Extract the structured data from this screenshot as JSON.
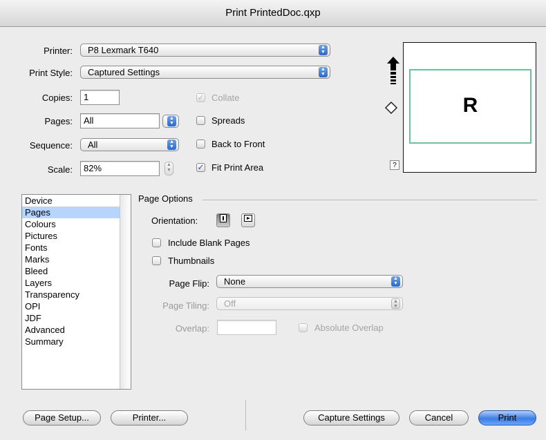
{
  "window": {
    "title": "Print PrintedDoc.qxp"
  },
  "form": {
    "printer_label": "Printer:",
    "printer_value": "P8 Lexmark T640",
    "style_label": "Print Style:",
    "style_value": "Captured Settings",
    "copies_label": "Copies:",
    "copies_value": "1",
    "pages_label": "Pages:",
    "pages_value": "All",
    "sequence_label": "Sequence:",
    "sequence_value": "All",
    "scale_label": "Scale:",
    "scale_value": "82%",
    "collate_label": "Collate",
    "spreads_label": "Spreads",
    "back_label": "Back to Front",
    "fit_label": "Fit Print Area"
  },
  "preview": {
    "letter": "R",
    "help": "?"
  },
  "sidebar": {
    "items": [
      "Device",
      "Pages",
      "Colours",
      "Pictures",
      "Fonts",
      "Marks",
      "Bleed",
      "Layers",
      "Transparency",
      "OPI",
      "JDF",
      "Advanced",
      "Summary"
    ],
    "selected": "Pages"
  },
  "page_options": {
    "section_title": "Page Options",
    "orientation_label": "Orientation:",
    "include_blank_label": "Include Blank Pages",
    "thumbnails_label": "Thumbnails",
    "page_flip_label": "Page Flip:",
    "page_flip_value": "None",
    "page_tiling_label": "Page Tiling:",
    "page_tiling_value": "Off",
    "overlap_label": "Overlap:",
    "overlap_value": "",
    "absolute_overlap_label": "Absolute Overlap"
  },
  "buttons": {
    "page_setup": "Page Setup...",
    "printer": "Printer...",
    "capture": "Capture Settings",
    "cancel": "Cancel",
    "print": "Print"
  },
  "icons": {
    "orientation_portrait": "portrait-icon",
    "orientation_landscape": "landscape-icon",
    "feed": "paper-feed-arrow-icon",
    "rotate": "rotate-tag-icon"
  },
  "colors": {
    "accent": "#3b7de3",
    "selection": "#b5d5ff",
    "preview_border": "#66c49a"
  }
}
